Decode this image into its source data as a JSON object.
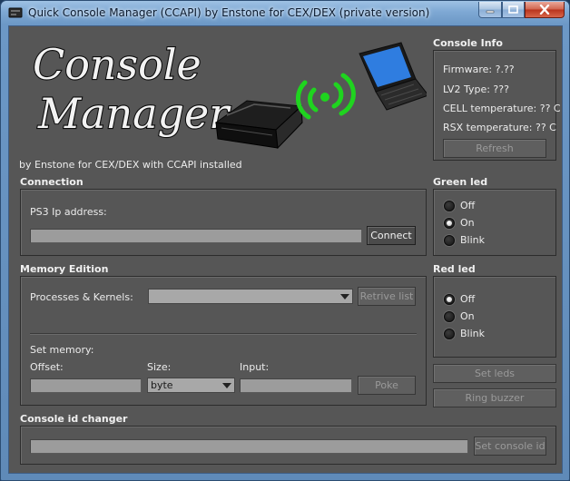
{
  "window": {
    "title": "Quick Console Manager (CCAPI) by Enstone for CEX/DEX (private version)"
  },
  "logo": {
    "line1": "Console",
    "line2": "Manager",
    "subtitle": "by Enstone for CEX/DEX with CCAPI installed"
  },
  "console_info": {
    "title": "Console Info",
    "firmware": "Firmware: ?.??",
    "lv2": "LV2 Type: ???",
    "cell": "CELL temperature: ?? C",
    "rsx": "RSX temperature: ?? C",
    "refresh_label": "Refresh"
  },
  "connection": {
    "title": "Connection",
    "ip_label": "PS3 Ip address:",
    "ip_value": "",
    "connect_label": "Connect"
  },
  "green_led": {
    "title": "Green led",
    "options": [
      "Off",
      "On",
      "Blink"
    ],
    "selected": "On"
  },
  "memory": {
    "title": "Memory Edition",
    "processes_label": "Processes & Kernels:",
    "processes_value": "",
    "retrieve_label": "Retrive list",
    "set_memory_label": "Set memory:",
    "offset_label": "Offset:",
    "offset_value": "",
    "size_label": "Size:",
    "size_value": "byte",
    "input_label": "Input:",
    "input_value": "",
    "poke_label": "Poke"
  },
  "red_led": {
    "title": "Red led",
    "options": [
      "Off",
      "On",
      "Blink"
    ],
    "selected": "Off"
  },
  "actions": {
    "set_leds_label": "Set leds",
    "ring_buzzer_label": "Ring buzzer"
  },
  "console_id": {
    "title": "Console id changer",
    "value": "",
    "set_label": "Set console id"
  },
  "colors": {
    "background": "#565656",
    "signal_green": "#1fd41f",
    "titlebar_blue": "#7ea8d4",
    "close_red": "#c8432a"
  }
}
